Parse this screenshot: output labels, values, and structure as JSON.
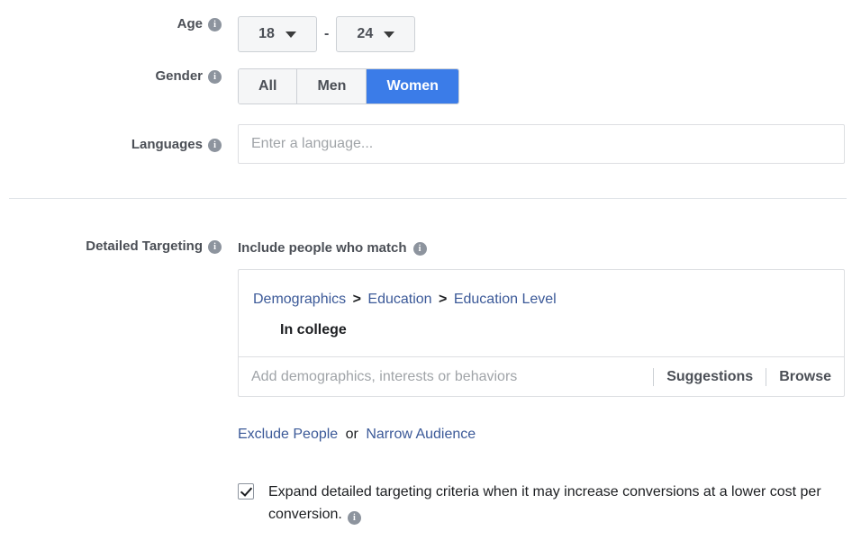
{
  "age": {
    "label": "Age",
    "info_icon": "info-icon",
    "min_value": "18",
    "max_value": "24",
    "separator": "-"
  },
  "gender": {
    "label": "Gender",
    "info_icon": "info-icon",
    "options": [
      "All",
      "Men",
      "Women"
    ],
    "selected": "Women",
    "selected_color": "#3b7ce8"
  },
  "languages": {
    "label": "Languages",
    "info_icon": "info-icon",
    "value": "",
    "placeholder": "Enter a language..."
  },
  "detailed_targeting": {
    "label": "Detailed Targeting",
    "info_icon": "info-icon",
    "include_heading": "Include people who match",
    "include_info_icon": "info-icon",
    "breadcrumb": {
      "items": [
        "Demographics",
        "Education",
        "Education Level"
      ],
      "separator": ">",
      "link_color": "#3b5998"
    },
    "selected_item": "In college",
    "search": {
      "value": "",
      "placeholder": "Add demographics, interests or behaviors",
      "suggestions_label": "Suggestions",
      "browse_label": "Browse"
    },
    "links": {
      "exclude_label": "Exclude People",
      "or_label": "or",
      "narrow_label": "Narrow Audience"
    },
    "expand_option": {
      "checked": true,
      "text": "Expand detailed targeting criteria when it may increase conversions at a lower cost per conversion.",
      "info_icon": "info-icon"
    }
  }
}
